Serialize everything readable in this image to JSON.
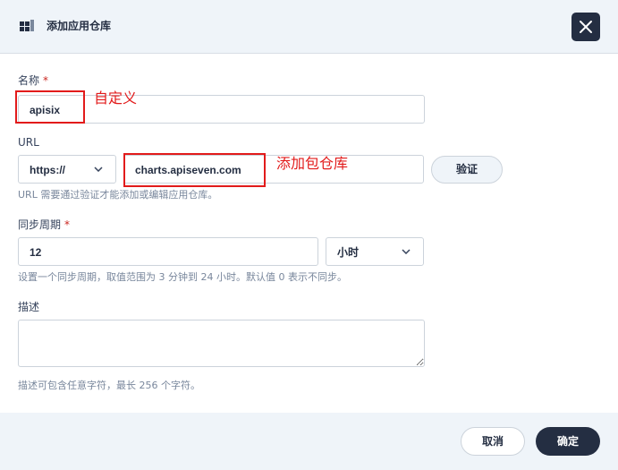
{
  "dialog": {
    "title": "添加应用仓库",
    "title_icon": "app-repository-icon",
    "close_icon": "close-icon"
  },
  "form": {
    "name": {
      "label": "名称",
      "required_mark": "*",
      "value": "apisix"
    },
    "url": {
      "label": "URL",
      "protocol": "https://",
      "value": "charts.apiseven.com",
      "verify_label": "验证",
      "hint": "URL 需要通过验证才能添加或编辑应用仓库。"
    },
    "sync": {
      "label": "同步周期",
      "required_mark": "*",
      "value": "12",
      "unit": "小时",
      "hint": "设置一个同步周期，取值范围为 3 分钟到 24 小时。默认值 0 表示不同步。"
    },
    "description": {
      "label": "描述",
      "value": "",
      "hint": "描述可包含任意字符，最长 256 个字符。"
    }
  },
  "annotations": {
    "name_note": "自定义",
    "url_note": "添加包仓库",
    "color": "#e21b1b"
  },
  "footer": {
    "cancel_label": "取消",
    "ok_label": "确定"
  },
  "colors": {
    "primary_dark": "#242e42",
    "header_bg": "#eff4f9",
    "required": "#ca2621"
  }
}
